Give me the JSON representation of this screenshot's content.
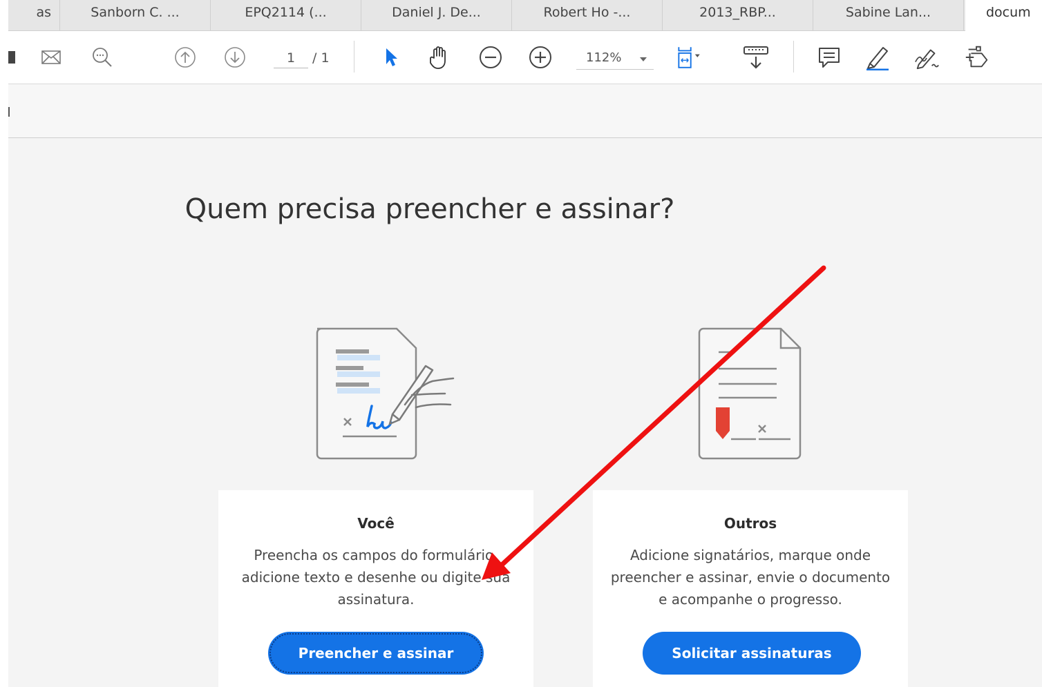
{
  "tabs": [
    {
      "label": "as"
    },
    {
      "label": "Sanborn C. ..."
    },
    {
      "label": "EPQ2114 (..."
    },
    {
      "label": "Daniel J. De..."
    },
    {
      "label": "Robert Ho -..."
    },
    {
      "label": "2013_RBP..."
    },
    {
      "label": "Sabine Lan..."
    },
    {
      "label": "docum"
    }
  ],
  "toolbar": {
    "page_current": "1",
    "page_total": "/ 1",
    "zoom_value": "112%",
    "icons": [
      "save-icon",
      "email-icon",
      "search-icon",
      "prev-page-icon",
      "next-page-icon",
      "select-arrow-icon",
      "hand-tool-icon",
      "zoom-out-icon",
      "zoom-in-icon",
      "fit-page-icon",
      "scroll-mode-icon",
      "comment-icon",
      "highlight-icon",
      "sign-icon",
      "fill-sign-icon"
    ]
  },
  "main": {
    "heading": "Quem precisa preencher e assinar?",
    "cards": [
      {
        "title": "Você",
        "description": "Preencha os campos do formulário, adicione texto e desenhe ou digite sua assinatura.",
        "button": "Preencher e assinar"
      },
      {
        "title": "Outros",
        "description": "Adicione signatários, marque onde preencher e assinar, envie o documento e acompanhe o progresso.",
        "button": "Solicitar assinaturas"
      }
    ]
  },
  "colors": {
    "accent": "#1473e6",
    "annotation_arrow": "#ee1111",
    "signature_blue": "#1473e6",
    "bookmark_red": "#e34234"
  }
}
